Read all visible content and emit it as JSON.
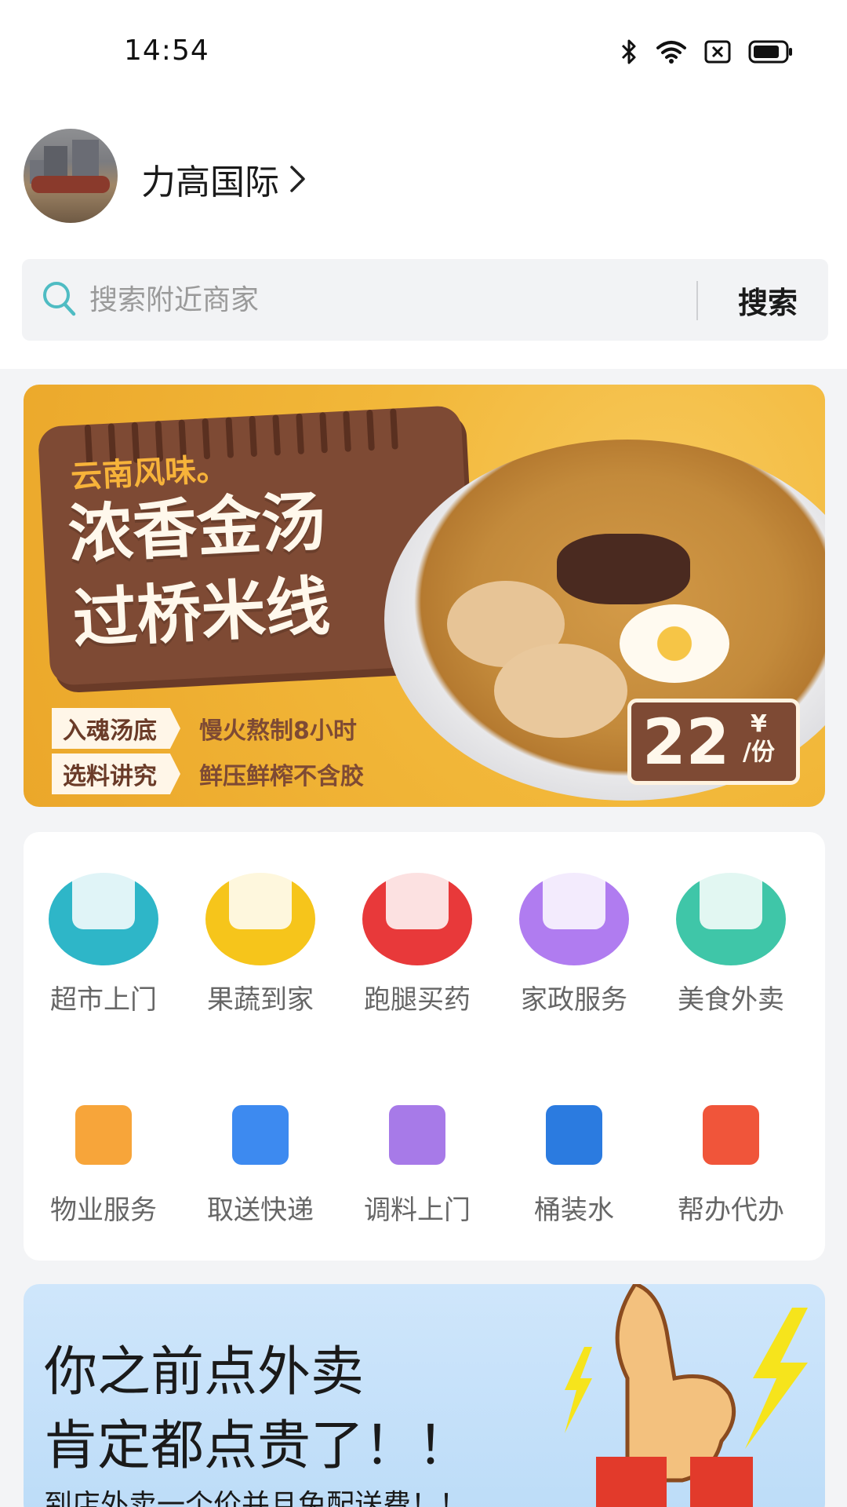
{
  "status_bar": {
    "time": "14:54",
    "icons": [
      "bluetooth-icon",
      "wifi-icon",
      "sim-off-icon",
      "battery-icon"
    ]
  },
  "location": {
    "name": "力高国际"
  },
  "search": {
    "placeholder": "搜索附近商家",
    "button_label": "搜索"
  },
  "banner": {
    "subtitle": "云南风味。",
    "title_line1": "浓香金汤",
    "title_line2": "过桥米线",
    "tags": [
      {
        "label": "入魂汤底",
        "desc": "慢火熬制8小时"
      },
      {
        "label": "选料讲究",
        "desc": "鲜压鲜榨不含胶"
      }
    ],
    "price": "22",
    "price_currency": "¥",
    "price_unit": "/份"
  },
  "services": [
    {
      "label": "超市上门",
      "icon": "basket-icon",
      "color": "#2eb6c8"
    },
    {
      "label": "果蔬到家",
      "icon": "watermelon-icon",
      "color": "#f6c51b"
    },
    {
      "label": "跑腿买药",
      "icon": "medicine-box-icon",
      "color": "#e8393a"
    },
    {
      "label": "家政服务",
      "icon": "cleaning-bucket-icon",
      "color": "#b07cf0"
    },
    {
      "label": "美食外卖",
      "icon": "scooter-icon",
      "color": "#3fc6a8"
    },
    {
      "label": "物业服务",
      "icon": "building-icon",
      "color": "#f7a53a"
    },
    {
      "label": "取送快递",
      "icon": "truck-icon",
      "color": "#3d8af0"
    },
    {
      "label": "调料上门",
      "icon": "seasoning-bottle-icon",
      "color": "#a77ae8"
    },
    {
      "label": "桶装水",
      "icon": "water-bucket-icon",
      "color": "#2b7be0"
    },
    {
      "label": "帮办代办",
      "icon": "heart-hand-icon",
      "color": "#f0553a"
    }
  ],
  "promo": {
    "line1": "你之前点外卖",
    "line2": "肯定都点贵了！！",
    "line3": "到店外卖一个价并且免配送费！！"
  }
}
